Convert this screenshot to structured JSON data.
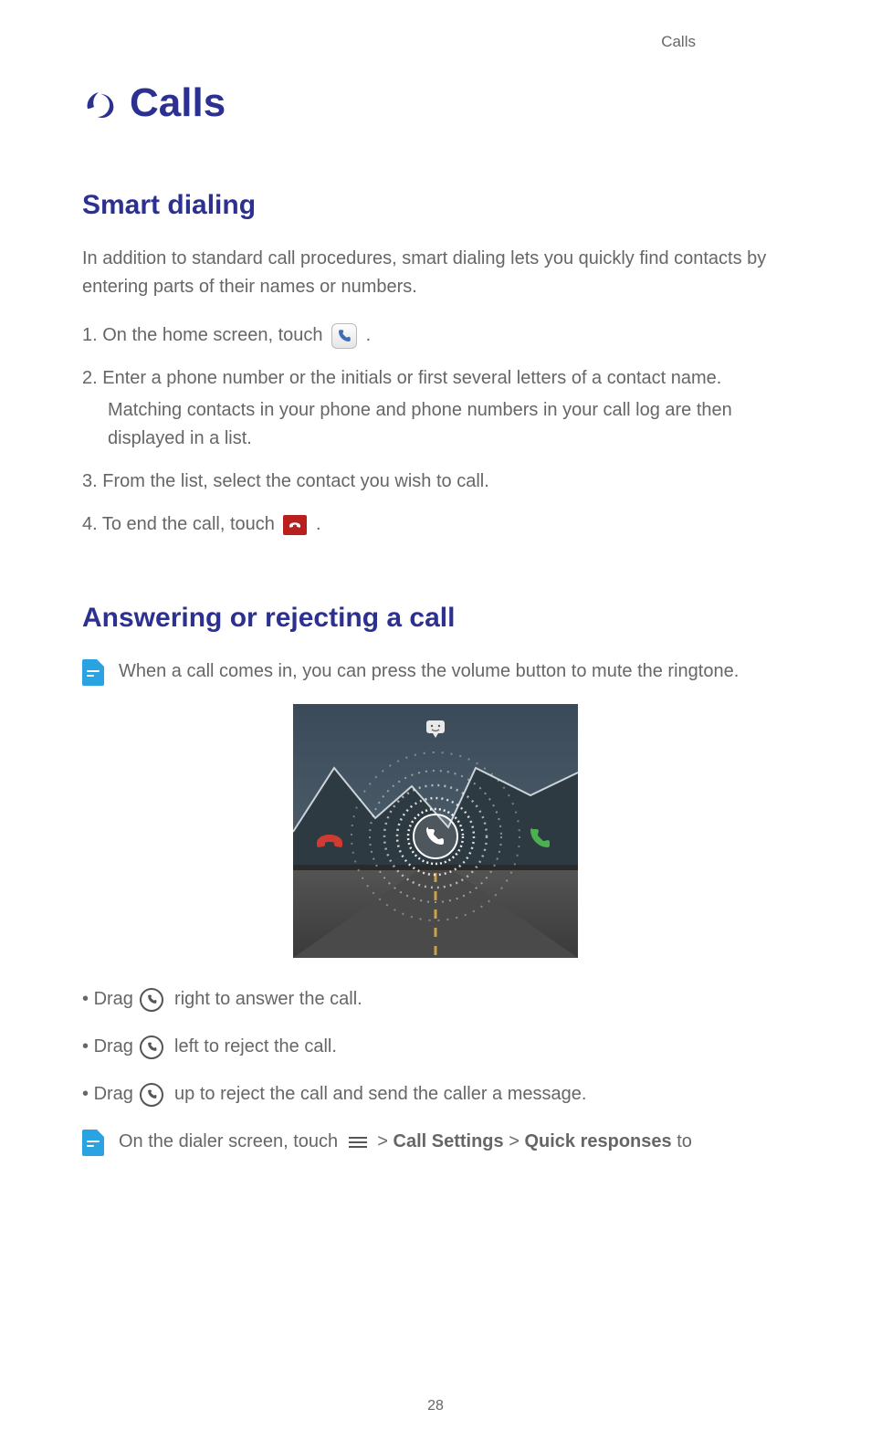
{
  "header": "Calls",
  "title": "Calls",
  "section1": {
    "heading": "Smart dialing",
    "intro": "In addition to standard call procedures, smart dialing lets you quickly find contacts by entering parts of their names or numbers.",
    "step1_pre": "On the home screen, touch",
    "step1_post": ".",
    "step2": "Enter a phone number or the initials or first several letters of a contact name.",
    "step2_sub": "Matching contacts in your phone and phone numbers in your call log are then displayed in a list.",
    "step3": "From the list, select the contact you wish to call.",
    "step4_pre": "To end the call, touch",
    "step4_post": "."
  },
  "section2": {
    "heading": "Answering or rejecting a call",
    "note": "When a call comes in, you can press the volume button to mute the ringtone.",
    "drag_word": "Drag",
    "b1_post": "right to answer the call.",
    "b2_post": "left to reject the call.",
    "b3_post": "up to reject the call and send the caller a message.",
    "note2_pre": "On the dialer screen, touch",
    "note2_gt1": " > ",
    "note2_b1": "Call Settings",
    "note2_gt2": " > ",
    "note2_b2": "Quick responses",
    "note2_post": " to"
  },
  "page_number": "28"
}
